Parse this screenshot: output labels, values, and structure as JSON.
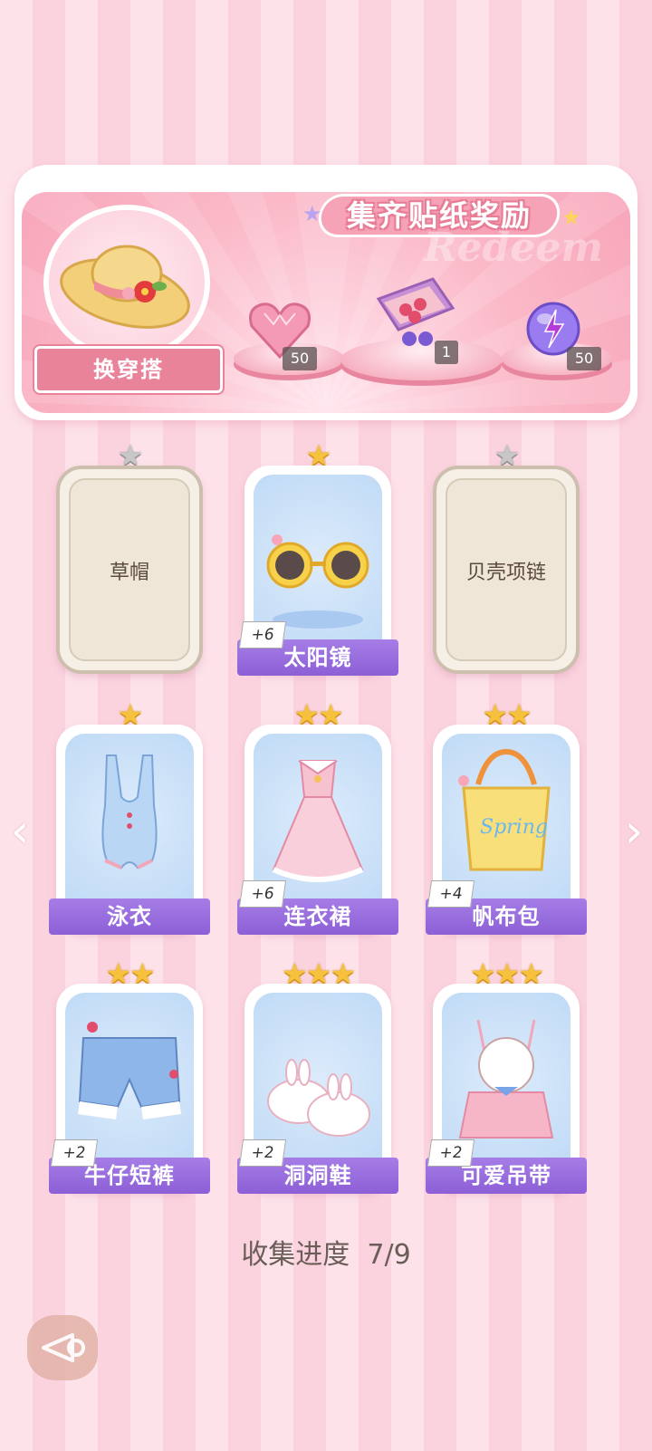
{
  "banner": {
    "title": "集齐贴纸奖励",
    "watermark": "Redeem",
    "swap_label": "换穿搭",
    "rewards": [
      {
        "icon": "pink-diamond-heart-icon",
        "count": "50"
      },
      {
        "icon": "gift-box-icon",
        "count": "1"
      },
      {
        "icon": "purple-energy-orb-icon",
        "count": "50"
      }
    ]
  },
  "items": [
    {
      "name": "草帽",
      "stars": 1,
      "unlocked": false,
      "bonus": ""
    },
    {
      "name": "太阳镜",
      "stars": 1,
      "unlocked": true,
      "bonus": "+6"
    },
    {
      "name": "贝壳项链",
      "stars": 1,
      "unlocked": false,
      "bonus": ""
    },
    {
      "name": "泳衣",
      "stars": 1,
      "unlocked": true,
      "bonus": ""
    },
    {
      "name": "连衣裙",
      "stars": 2,
      "unlocked": true,
      "bonus": "+6"
    },
    {
      "name": "帆布包",
      "stars": 2,
      "unlocked": true,
      "bonus": "+4"
    },
    {
      "name": "牛仔短裤",
      "stars": 2,
      "unlocked": true,
      "bonus": "+2"
    },
    {
      "name": "洞洞鞋",
      "stars": 3,
      "unlocked": true,
      "bonus": "+2"
    },
    {
      "name": "可爱吊带",
      "stars": 3,
      "unlocked": true,
      "bonus": "+2"
    }
  ],
  "progress": {
    "label": "收集进度",
    "value": "7/9"
  },
  "nav": {
    "left_arrow": "‹",
    "right_arrow": "›"
  },
  "colors": {
    "label_purple": "#8c5fd6",
    "banner_pink": "#f7a6ba",
    "star_gold": "#f6c23e"
  }
}
